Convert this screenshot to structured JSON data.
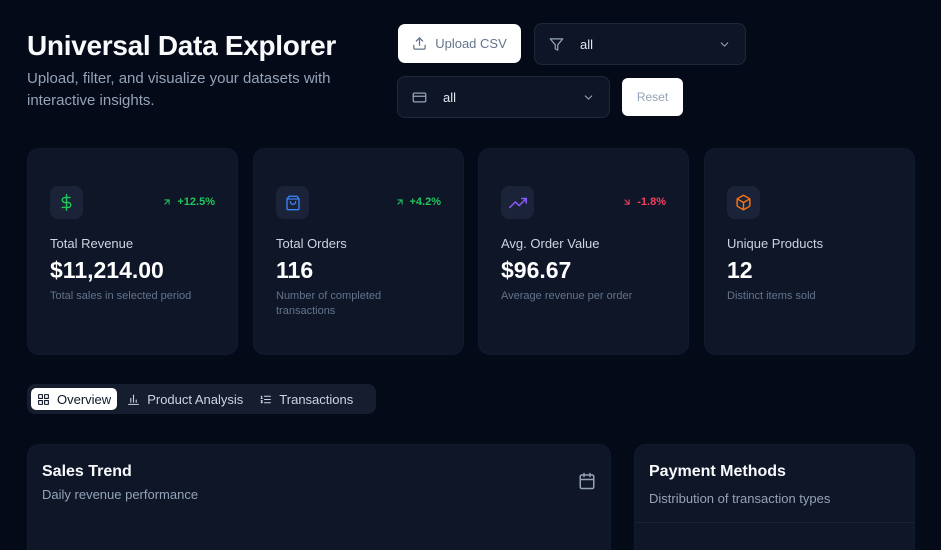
{
  "header": {
    "title": "Universal Data Explorer",
    "subtitle": "Upload, filter, and visualize your datasets with interactive insights."
  },
  "controls": {
    "upload_label": "Upload CSV",
    "filter_value": "all",
    "payment_value": "all",
    "reset_label": "Reset"
  },
  "stats": [
    {
      "label": "Total Revenue",
      "value": "$11,214.00",
      "desc": "Total sales in selected period",
      "trend": "+12.5%",
      "trend_dir": "up",
      "icon": "dollar-icon",
      "icon_color": "#22c55e"
    },
    {
      "label": "Total Orders",
      "value": "116",
      "desc": "Number of completed transactions",
      "trend": "+4.2%",
      "trend_dir": "up",
      "icon": "shopping-bag-icon",
      "icon_color": "#3b82f6"
    },
    {
      "label": "Avg. Order Value",
      "value": "$96.67",
      "desc": "Average revenue per order",
      "trend": "-1.8%",
      "trend_dir": "down",
      "icon": "trending-up-icon",
      "icon_color": "#8b5cf6"
    },
    {
      "label": "Unique Products",
      "value": "12",
      "desc": "Distinct items sold",
      "icon": "package-icon",
      "icon_color": "#f97316"
    }
  ],
  "tabs": [
    {
      "label": "Overview",
      "active": true
    },
    {
      "label": "Product Analysis",
      "active": false
    },
    {
      "label": "Transactions",
      "active": false
    }
  ],
  "panels": {
    "sales_trend": {
      "title": "Sales Trend",
      "subtitle": "Daily revenue performance"
    },
    "payment_methods": {
      "title": "Payment Methods",
      "subtitle": "Distribution of transaction types"
    }
  }
}
